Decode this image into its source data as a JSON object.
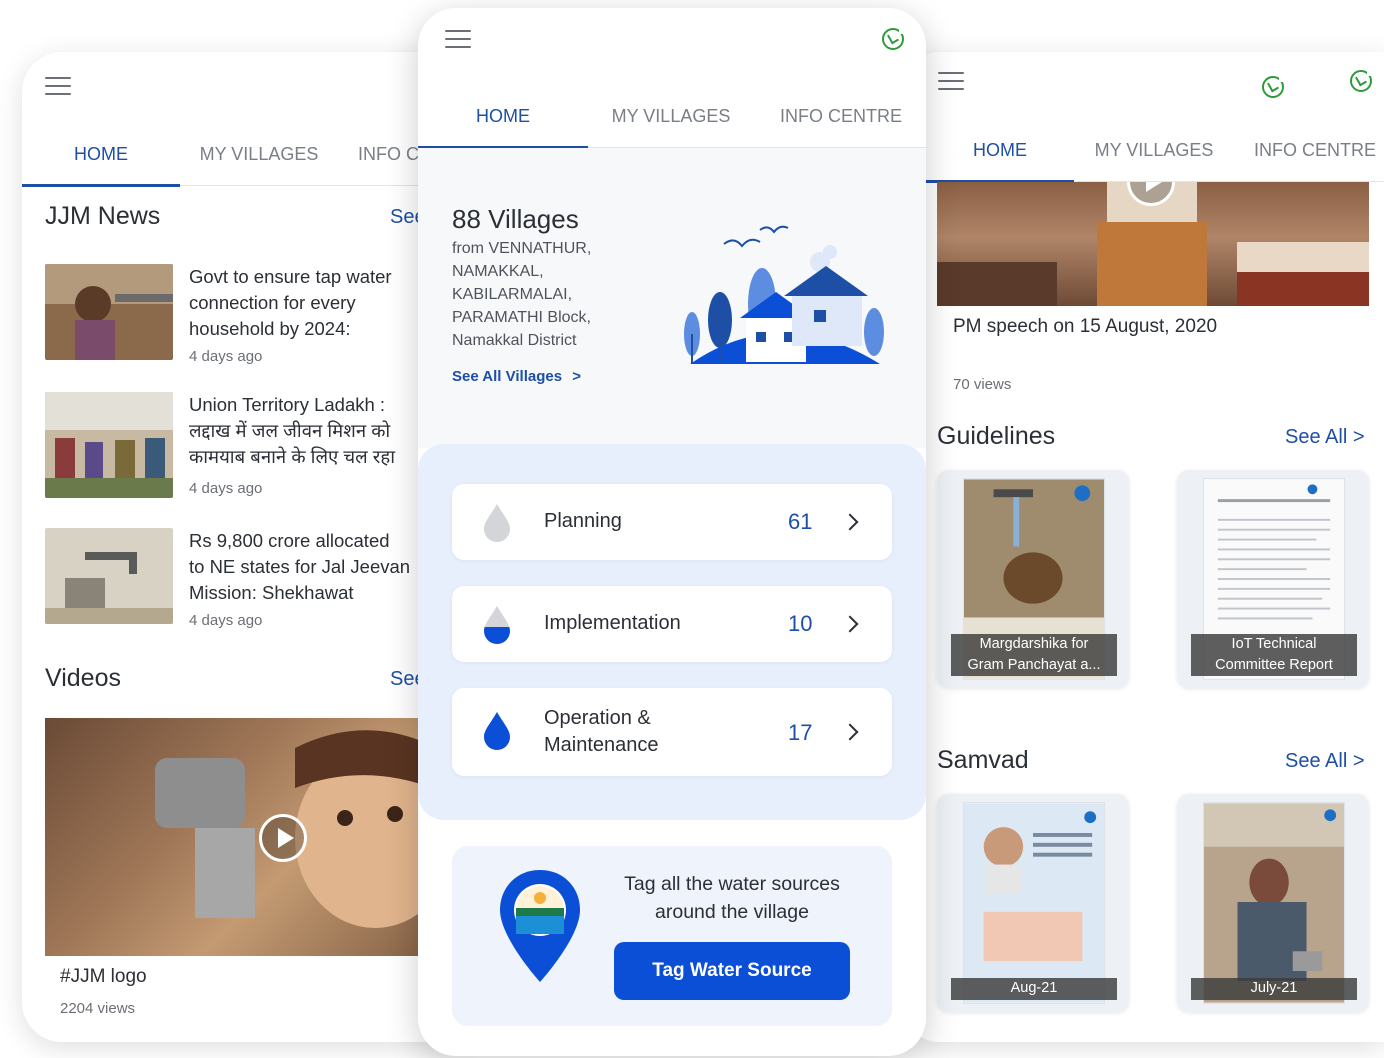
{
  "tabs": {
    "home": "HOME",
    "my_villages": "MY VILLAGES",
    "info_centre": "INFO CENTRE",
    "info_centre_cut": "INFO C"
  },
  "left": {
    "news_title": "JJM News",
    "see_all_cut": "See",
    "news": [
      {
        "title_line1": "Govt to ensure tap water",
        "title_line2": "connection for every",
        "title_line3": "household by 2024:",
        "meta": "4 days ago"
      },
      {
        "title_line1": "Union Territory Ladakh :",
        "title_line2": "लद्दाख में जल जीवन मिशन को",
        "title_line3": "कामयाब बनाने के लिए चल रहा",
        "meta": "4 days ago"
      },
      {
        "title_line1": "Rs 9,800 crore allocated",
        "title_line2": "to NE states for Jal Jeevan",
        "title_line3": "Mission: Shekhawat",
        "meta": "4 days ago"
      }
    ],
    "videos_title": "Videos",
    "video": {
      "title": "#JJM logo",
      "views": "2204 views"
    }
  },
  "center": {
    "villages_count": "88 Villages",
    "villages_desc": "from VENNATHUR,\nNAMAKKAL,\nKABILARMALAI,\nPARAMATHI Block,\nNamakkal District",
    "see_all_villages": "See All Villages",
    "see_all_villages_chev": ">",
    "status": [
      {
        "label": "Planning",
        "count": "61",
        "fill": "grey"
      },
      {
        "label": "Implementation",
        "count": "10",
        "fill": "half"
      },
      {
        "label": "Operation &\nMaintenance",
        "count": "17",
        "fill": "full"
      }
    ],
    "tag_text": "Tag all the water sources around the village",
    "tag_button": "Tag Water Source"
  },
  "right": {
    "video": {
      "title": "PM speech on 15 August, 2020",
      "views": "70 views"
    },
    "guidelines_title": "Guidelines",
    "guidelines_see_all": "See All >",
    "guidelines": [
      {
        "caption": "Margdarshika for\nGram Panchayat a..."
      },
      {
        "caption": "IoT Technical\nCommittee Report"
      }
    ],
    "samvad_title": "Samvad",
    "samvad_see_all": "See All >",
    "samvad": [
      {
        "caption": "Aug-21"
      },
      {
        "caption": "July-21"
      }
    ]
  },
  "colors": {
    "primary": "#1d4fa6",
    "button": "#0b4fd6",
    "sync": "#2e9b3a",
    "panel": "#e8effc"
  },
  "icons": [
    "menu-icon",
    "sync-icon",
    "water-drop-icon",
    "chevron-right-icon",
    "location-pin-icon",
    "play-icon"
  ]
}
